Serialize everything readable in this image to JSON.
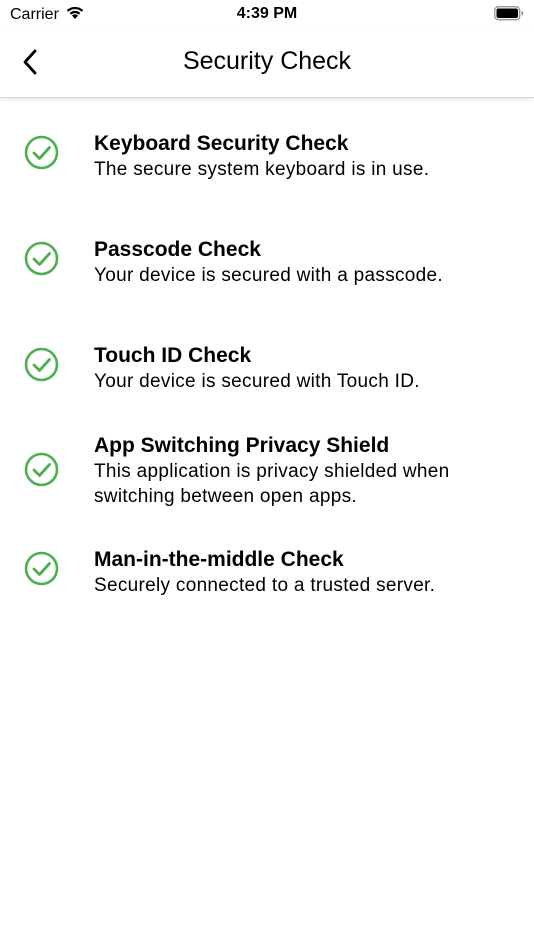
{
  "status_bar": {
    "carrier": "Carrier",
    "time": "4:39 PM",
    "icons": [
      "wifi-icon",
      "battery-icon"
    ]
  },
  "nav": {
    "title": "Security Check",
    "back_icon": "chevron-left-icon"
  },
  "colors": {
    "check_green": "#4caf50",
    "text": "#000000",
    "divider": "#d8d8d8"
  },
  "checks": [
    {
      "title": "Keyboard Security Check",
      "description": "The secure system keyboard is in use.",
      "status": "passed"
    },
    {
      "title": "Passcode Check",
      "description": "Your device is secured with a passcode.",
      "status": "passed"
    },
    {
      "title": "Touch ID Check",
      "description": "Your device is secured with Touch ID.",
      "status": "passed"
    },
    {
      "title": "App Switching Privacy Shield",
      "description": "This application is privacy shielded when switching between open apps.",
      "status": "passed"
    },
    {
      "title": "Man-in-the-middle Check",
      "description": "Securely connected to a trusted server.",
      "status": "passed"
    }
  ]
}
